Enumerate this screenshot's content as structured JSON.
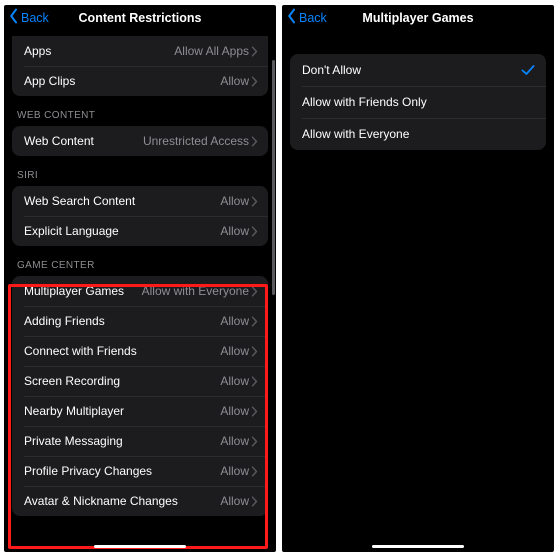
{
  "left": {
    "back": "Back",
    "title": "Content Restrictions",
    "topGroup": [
      {
        "label": "Apps",
        "value": "Allow All Apps"
      },
      {
        "label": "App Clips",
        "value": "Allow"
      }
    ],
    "webHeader": "WEB CONTENT",
    "webGroup": [
      {
        "label": "Web Content",
        "value": "Unrestricted Access"
      }
    ],
    "siriHeader": "SIRI",
    "siriGroup": [
      {
        "label": "Web Search Content",
        "value": "Allow"
      },
      {
        "label": "Explicit Language",
        "value": "Allow"
      }
    ],
    "gcHeader": "GAME CENTER",
    "gcGroup": [
      {
        "label": "Multiplayer Games",
        "value": "Allow with Everyone"
      },
      {
        "label": "Adding Friends",
        "value": "Allow"
      },
      {
        "label": "Connect with Friends",
        "value": "Allow"
      },
      {
        "label": "Screen Recording",
        "value": "Allow"
      },
      {
        "label": "Nearby Multiplayer",
        "value": "Allow"
      },
      {
        "label": "Private Messaging",
        "value": "Allow"
      },
      {
        "label": "Profile Privacy Changes",
        "value": "Allow"
      },
      {
        "label": "Avatar & Nickname Changes",
        "value": "Allow"
      }
    ]
  },
  "right": {
    "back": "Back",
    "title": "Multiplayer Games",
    "options": [
      {
        "label": "Don't Allow",
        "selected": true
      },
      {
        "label": "Allow with Friends Only",
        "selected": false
      },
      {
        "label": "Allow with Everyone",
        "selected": false
      }
    ]
  }
}
